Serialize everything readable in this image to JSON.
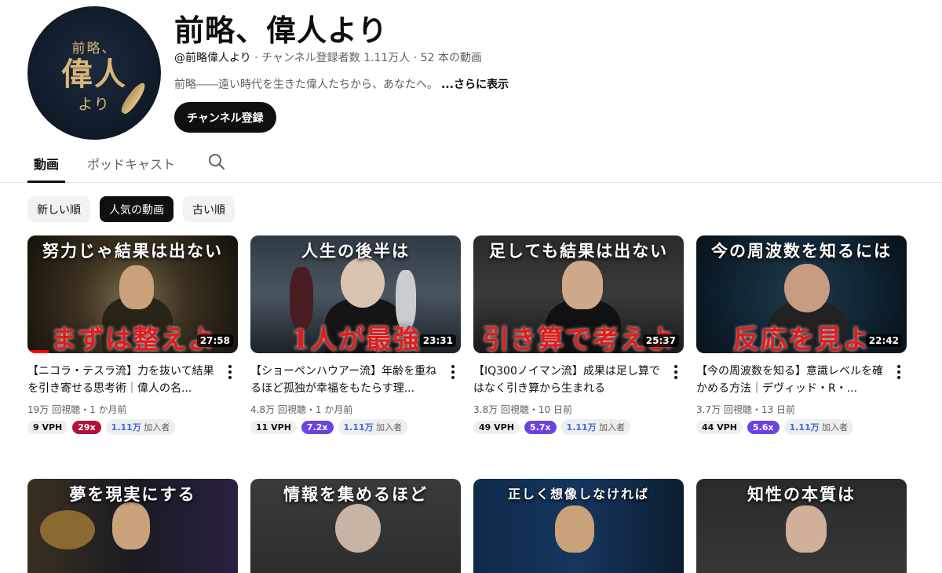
{
  "channel": {
    "avatar_line1": "前略、",
    "avatar_line2": "偉人",
    "avatar_line3": "より",
    "title": "前略、偉人より",
    "handle": "@前略偉人より",
    "meta_rest": " · チャンネル登録者数 1.11万人 · 52 本の動画",
    "description": "前略――遠い時代を生きた偉人たちから、あなたへ。",
    "more": "...さらに表示",
    "subscribe_label": "チャンネル登録"
  },
  "tabs": [
    {
      "label": "動画",
      "active": true
    },
    {
      "label": "ポッドキャスト",
      "active": false
    }
  ],
  "search_icon": "search-icon",
  "chips": [
    {
      "label": "新しい順",
      "active": false
    },
    {
      "label": "人気の動画",
      "active": true
    },
    {
      "label": "古い順",
      "active": false
    }
  ],
  "videos": [
    {
      "thumb_top": "努力じゃ結果は出ない",
      "thumb_bottom": "まずは整えよ",
      "duration": "27:58",
      "watched": 0.1,
      "title": "【ニコラ・テスラ流】力を抜いて結果を引き寄せる思考術｜偉人の名...",
      "meta": "19万 回視聴・1 か月前",
      "vph": "9 VPH",
      "mult": "29x",
      "mult_color": "#b0123a",
      "subs_num": "1.11万",
      "subs_label": " 加入者"
    },
    {
      "thumb_top": "人生の後半は",
      "thumb_bottom": "1人が最強",
      "duration": "23:31",
      "title": "【ショーペンハウアー流】年齢を重ねるほど孤独が幸福をもたらす理...",
      "meta": "4.8万 回視聴・1 か月前",
      "vph": "11 VPH",
      "mult": "7.2x",
      "mult_color": "#6b43e0",
      "subs_num": "1.11万",
      "subs_label": " 加入者"
    },
    {
      "thumb_top": "足しても結果は出ない",
      "thumb_bottom": "引き算で考えよ",
      "duration": "25:37",
      "title": "【IQ300ノイマン流】成果は足し算ではなく引き算から生まれる",
      "meta": "3.8万 回視聴・10 日前",
      "vph": "49 VPH",
      "mult": "5.7x",
      "mult_color": "#6b43e0",
      "subs_num": "1.11万",
      "subs_label": " 加入者"
    },
    {
      "thumb_top": "今の周波数を知るには",
      "thumb_bottom": "反応を見よ",
      "duration": "22:42",
      "title": "【今の周波数を知る】意識レベルを確かめる方法｜デヴィッド・R・...",
      "meta": "3.7万 回視聴・13 日前",
      "vph": "44 VPH",
      "mult": "5.6x",
      "mult_color": "#6b43e0",
      "subs_num": "1.11万",
      "subs_label": " 加入者"
    }
  ],
  "row2": [
    {
      "thumb_top": "夢を現実にする"
    },
    {
      "thumb_top": "情報を集めるほど"
    },
    {
      "thumb_top": "正しく想像しなければ"
    },
    {
      "thumb_top": "知性の本質は"
    }
  ]
}
